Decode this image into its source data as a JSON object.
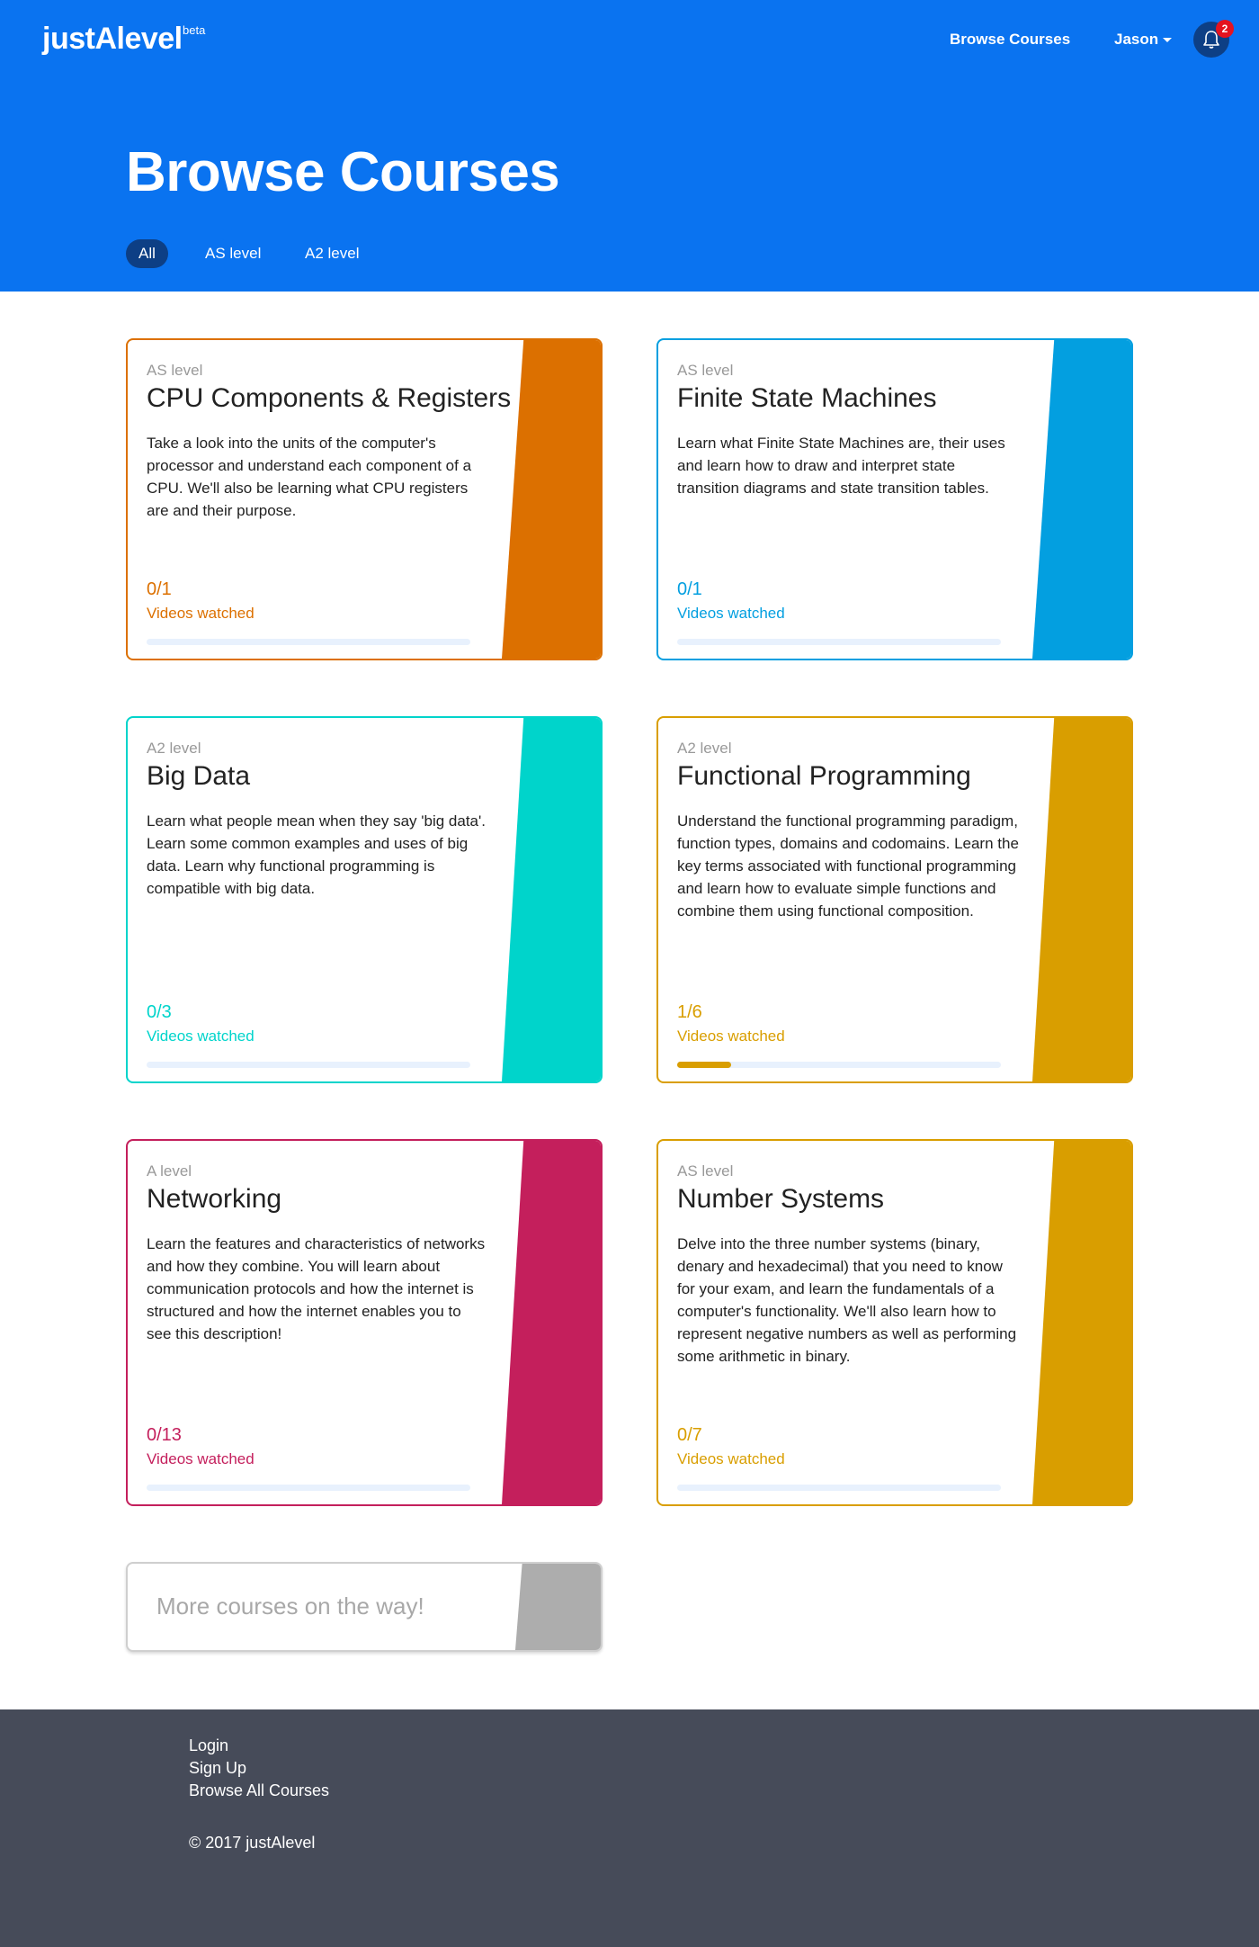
{
  "header": {
    "logo": "justAlevel",
    "logo_tag": "beta",
    "nav_browse": "Browse Courses",
    "nav_user": "Jason",
    "notification_count": "2",
    "page_title": "Browse Courses",
    "filters": [
      "All",
      "AS level",
      "A2 level"
    ],
    "active_filter": "All"
  },
  "courses": [
    {
      "level": "AS level",
      "title": "CPU Components & Registers",
      "description": "Take a look into the units of the computer's processor and understand each component of a CPU. We'll also be learning what CPU registers are and their purpose.",
      "progress_text": "0/1",
      "progress": 0,
      "watched_label": "Videos watched",
      "color": "#dc7000"
    },
    {
      "level": "AS level",
      "title": "Finite State Machines",
      "description": "Learn what Finite State Machines are, their uses and learn how to draw and interpret state transition diagrams and state transition tables.",
      "progress_text": "0/1",
      "progress": 0,
      "watched_label": "Videos watched",
      "color": "#039fe0"
    },
    {
      "level": "A2 level",
      "title": "Big Data",
      "description": "Learn what people mean when they say 'big data'. Learn some common examples and uses of big data. Learn why functional programming is compatible with big data.",
      "progress_text": "0/3",
      "progress": 0,
      "watched_label": "Videos watched",
      "color": "#00d4cb"
    },
    {
      "level": "A2 level",
      "title": "Functional Programming",
      "description": "Understand the functional programming paradigm, function types, domains and codomains. Learn the key terms associated with functional programming and learn how to evaluate simple functions and combine them using functional composition.",
      "progress_text": "1/6",
      "progress": 0.167,
      "watched_label": "Videos watched",
      "color": "#d99e00"
    },
    {
      "level": "A level",
      "title": "Networking",
      "description": "Learn the features and characteristics of networks and how they combine. You will learn about communication protocols and how the internet is structured and how the internet enables you to see this description!",
      "progress_text": "0/13",
      "progress": 0,
      "watched_label": "Videos watched",
      "color": "#c41f5c"
    },
    {
      "level": "AS level",
      "title": "Number Systems",
      "description": "Delve into the three number systems (binary, denary and hexadecimal) that you need to know for your exam, and learn the fundamentals of a computer's functionality. We'll also learn how to represent negative numbers as well as performing some arithmetic in binary.",
      "progress_text": "0/7",
      "progress": 0,
      "watched_label": "Videos watched",
      "color": "#d99e00"
    }
  ],
  "more_courses": "More courses on the way!",
  "footer": {
    "links": [
      "Login",
      "Sign Up",
      "Browse All Courses"
    ],
    "copyright": "© 2017 justAlevel"
  }
}
